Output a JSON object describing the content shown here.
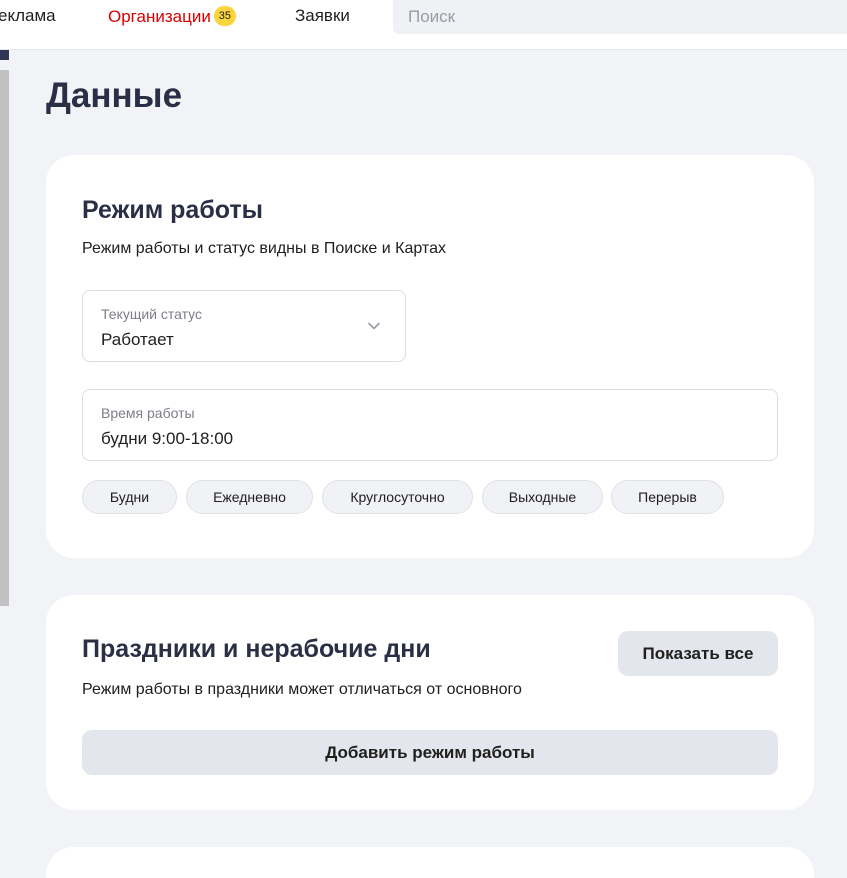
{
  "header": {
    "nav": [
      {
        "label": "еклама"
      },
      {
        "label": "Организации",
        "badge": "35"
      },
      {
        "label": "Заявки"
      }
    ],
    "search": {
      "placeholder": "Поиск",
      "value": ""
    }
  },
  "page": {
    "title": "Данные"
  },
  "schedule_card": {
    "title": "Режим работы",
    "subtitle": "Режим работы и статус видны в Поиске и Картах",
    "status_field": {
      "label": "Текущий статус",
      "value": "Работает",
      "icon": "chevron-down-icon"
    },
    "hours_field": {
      "label": "Время работы",
      "value": "будни 9:00-18:00"
    },
    "chips": [
      "Будни",
      "Ежедневно",
      "Круглосуточно",
      "Выходные",
      "Перерыв"
    ]
  },
  "holidays_card": {
    "title": "Праздники и нерабочие дни",
    "subtitle": "Режим работы в праздники может отличаться от основного",
    "show_all_label": "Показать все",
    "add_label": "Добавить режим работы"
  },
  "colors": {
    "accent_red": "#d80000",
    "badge_yellow": "#fcd43e",
    "page_bg": "#f2f3f7",
    "button_bg": "#e4e6ed"
  }
}
